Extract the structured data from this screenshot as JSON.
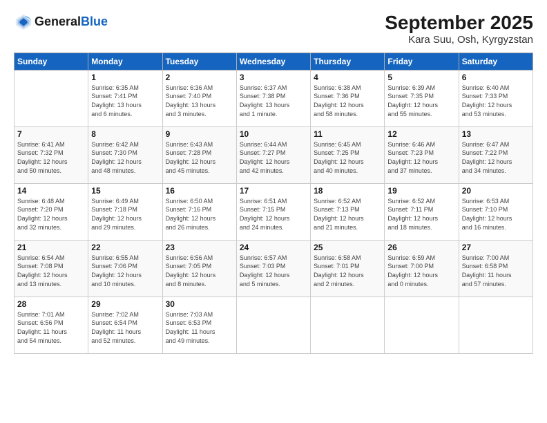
{
  "logo": {
    "general": "General",
    "blue": "Blue"
  },
  "header": {
    "title": "September 2025",
    "subtitle": "Kara Suu, Osh, Kyrgyzstan"
  },
  "days": [
    "Sunday",
    "Monday",
    "Tuesday",
    "Wednesday",
    "Thursday",
    "Friday",
    "Saturday"
  ],
  "weeks": [
    [
      {
        "day": "",
        "info": ""
      },
      {
        "day": "1",
        "info": "Sunrise: 6:35 AM\nSunset: 7:41 PM\nDaylight: 13 hours\nand 6 minutes."
      },
      {
        "day": "2",
        "info": "Sunrise: 6:36 AM\nSunset: 7:40 PM\nDaylight: 13 hours\nand 3 minutes."
      },
      {
        "day": "3",
        "info": "Sunrise: 6:37 AM\nSunset: 7:38 PM\nDaylight: 13 hours\nand 1 minute."
      },
      {
        "day": "4",
        "info": "Sunrise: 6:38 AM\nSunset: 7:36 PM\nDaylight: 12 hours\nand 58 minutes."
      },
      {
        "day": "5",
        "info": "Sunrise: 6:39 AM\nSunset: 7:35 PM\nDaylight: 12 hours\nand 55 minutes."
      },
      {
        "day": "6",
        "info": "Sunrise: 6:40 AM\nSunset: 7:33 PM\nDaylight: 12 hours\nand 53 minutes."
      }
    ],
    [
      {
        "day": "7",
        "info": "Sunrise: 6:41 AM\nSunset: 7:32 PM\nDaylight: 12 hours\nand 50 minutes."
      },
      {
        "day": "8",
        "info": "Sunrise: 6:42 AM\nSunset: 7:30 PM\nDaylight: 12 hours\nand 48 minutes."
      },
      {
        "day": "9",
        "info": "Sunrise: 6:43 AM\nSunset: 7:28 PM\nDaylight: 12 hours\nand 45 minutes."
      },
      {
        "day": "10",
        "info": "Sunrise: 6:44 AM\nSunset: 7:27 PM\nDaylight: 12 hours\nand 42 minutes."
      },
      {
        "day": "11",
        "info": "Sunrise: 6:45 AM\nSunset: 7:25 PM\nDaylight: 12 hours\nand 40 minutes."
      },
      {
        "day": "12",
        "info": "Sunrise: 6:46 AM\nSunset: 7:23 PM\nDaylight: 12 hours\nand 37 minutes."
      },
      {
        "day": "13",
        "info": "Sunrise: 6:47 AM\nSunset: 7:22 PM\nDaylight: 12 hours\nand 34 minutes."
      }
    ],
    [
      {
        "day": "14",
        "info": "Sunrise: 6:48 AM\nSunset: 7:20 PM\nDaylight: 12 hours\nand 32 minutes."
      },
      {
        "day": "15",
        "info": "Sunrise: 6:49 AM\nSunset: 7:18 PM\nDaylight: 12 hours\nand 29 minutes."
      },
      {
        "day": "16",
        "info": "Sunrise: 6:50 AM\nSunset: 7:16 PM\nDaylight: 12 hours\nand 26 minutes."
      },
      {
        "day": "17",
        "info": "Sunrise: 6:51 AM\nSunset: 7:15 PM\nDaylight: 12 hours\nand 24 minutes."
      },
      {
        "day": "18",
        "info": "Sunrise: 6:52 AM\nSunset: 7:13 PM\nDaylight: 12 hours\nand 21 minutes."
      },
      {
        "day": "19",
        "info": "Sunrise: 6:52 AM\nSunset: 7:11 PM\nDaylight: 12 hours\nand 18 minutes."
      },
      {
        "day": "20",
        "info": "Sunrise: 6:53 AM\nSunset: 7:10 PM\nDaylight: 12 hours\nand 16 minutes."
      }
    ],
    [
      {
        "day": "21",
        "info": "Sunrise: 6:54 AM\nSunset: 7:08 PM\nDaylight: 12 hours\nand 13 minutes."
      },
      {
        "day": "22",
        "info": "Sunrise: 6:55 AM\nSunset: 7:06 PM\nDaylight: 12 hours\nand 10 minutes."
      },
      {
        "day": "23",
        "info": "Sunrise: 6:56 AM\nSunset: 7:05 PM\nDaylight: 12 hours\nand 8 minutes."
      },
      {
        "day": "24",
        "info": "Sunrise: 6:57 AM\nSunset: 7:03 PM\nDaylight: 12 hours\nand 5 minutes."
      },
      {
        "day": "25",
        "info": "Sunrise: 6:58 AM\nSunset: 7:01 PM\nDaylight: 12 hours\nand 2 minutes."
      },
      {
        "day": "26",
        "info": "Sunrise: 6:59 AM\nSunset: 7:00 PM\nDaylight: 12 hours\nand 0 minutes."
      },
      {
        "day": "27",
        "info": "Sunrise: 7:00 AM\nSunset: 6:58 PM\nDaylight: 11 hours\nand 57 minutes."
      }
    ],
    [
      {
        "day": "28",
        "info": "Sunrise: 7:01 AM\nSunset: 6:56 PM\nDaylight: 11 hours\nand 54 minutes."
      },
      {
        "day": "29",
        "info": "Sunrise: 7:02 AM\nSunset: 6:54 PM\nDaylight: 11 hours\nand 52 minutes."
      },
      {
        "day": "30",
        "info": "Sunrise: 7:03 AM\nSunset: 6:53 PM\nDaylight: 11 hours\nand 49 minutes."
      },
      {
        "day": "",
        "info": ""
      },
      {
        "day": "",
        "info": ""
      },
      {
        "day": "",
        "info": ""
      },
      {
        "day": "",
        "info": ""
      }
    ]
  ]
}
